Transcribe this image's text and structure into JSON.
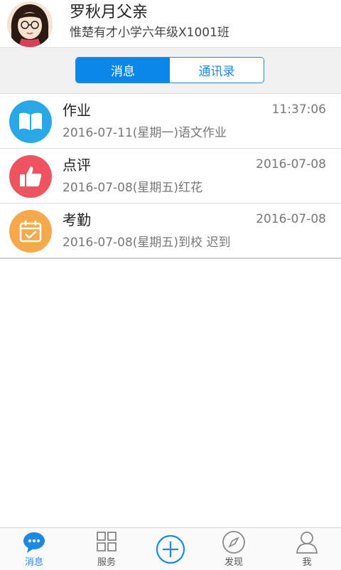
{
  "header": {
    "name": "罗秋月父亲",
    "class_name": "惟楚有才小学六年级X1001班"
  },
  "tabs": [
    {
      "label": "消息",
      "active": true
    },
    {
      "label": "通讯录",
      "active": false
    }
  ],
  "messages": [
    {
      "title": "作业",
      "time": "11:37:06",
      "subtitle": "2016-07-11(星期一)语文作业",
      "icon": "book-icon",
      "color": "#29a8e8"
    },
    {
      "title": "点评",
      "time": "2016-07-08",
      "subtitle": "2016-07-08(星期五)红花",
      "icon": "thumbs-up-icon",
      "color": "#ee5360"
    },
    {
      "title": "考勤",
      "time": "2016-07-08",
      "subtitle": "2016-07-08(星期五)到校 迟到",
      "icon": "calendar-check-icon",
      "color": "#f6a94a"
    }
  ],
  "bottom_nav": [
    {
      "label": "消息",
      "icon": "chat-bubble-icon",
      "active": true
    },
    {
      "label": "服务",
      "icon": "grid-icon",
      "active": false
    },
    {
      "label": "",
      "icon": "plus-circle-icon",
      "active": false
    },
    {
      "label": "发现",
      "icon": "compass-icon",
      "active": false
    },
    {
      "label": "我",
      "icon": "person-icon",
      "active": false
    }
  ],
  "colors": {
    "accent": "#0a87e8"
  }
}
